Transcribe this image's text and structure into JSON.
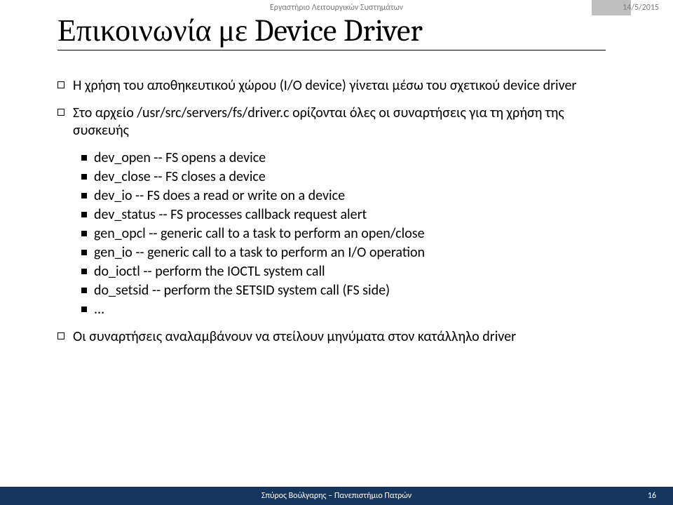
{
  "header": {
    "lab": "Εργαστήριο Λειτουργικών Συστημάτων",
    "date": "14/5/2015"
  },
  "title": "Επικοινωνία με Device Driver",
  "bullets": {
    "b1": "Η χρήση του αποθηκευτικού χώρου (I/O device) γίνεται μέσω του σχετικού device driver",
    "b2": "Στο αρχείο /usr/src/servers/fs/driver.c ορίζονται όλες οι συναρτήσεις για τη χρήση της συσκευής",
    "b2_items": [
      "dev_open -- FS opens a device",
      "dev_close -- FS closes a device",
      "dev_io -- FS does a read or write on a device",
      "dev_status -- FS processes callback request alert",
      "gen_opcl -- generic call to a task to perform an open/close",
      "gen_io -- generic call to a task to perform an I/O operation",
      "do_ioctl -- perform the IOCTL system call",
      "do_setsid -- perform the SETSID system call (FS side)",
      "..."
    ],
    "b3": "Οι συναρτήσεις αναλαμβάνουν να στείλουν μηνύματα στον κατάλληλο driver"
  },
  "footer": {
    "author": "Σπύρος Βούλγαρης – Πανεπιστήμιο Πατρών",
    "page": "16"
  }
}
